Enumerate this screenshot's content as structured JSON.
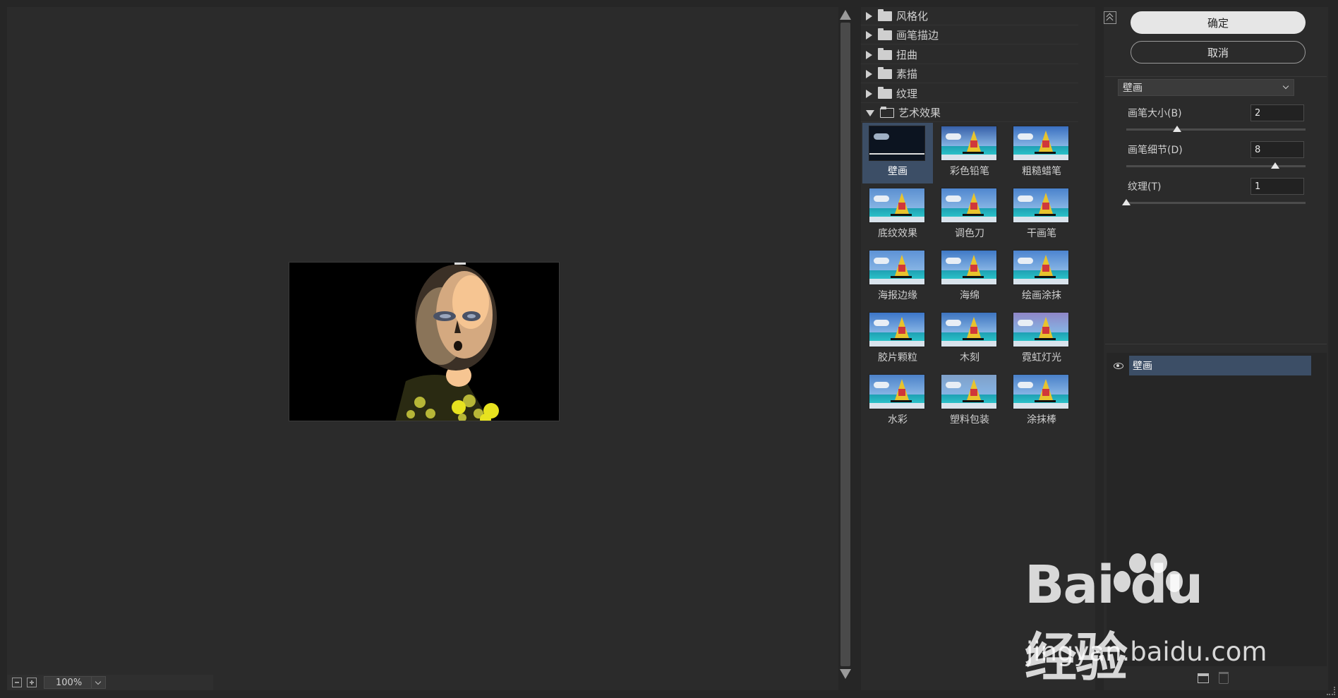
{
  "categories": [
    {
      "label": "风格化",
      "open": false
    },
    {
      "label": "画笔描边",
      "open": false
    },
    {
      "label": "扭曲",
      "open": false
    },
    {
      "label": "素描",
      "open": false
    },
    {
      "label": "纹理",
      "open": false
    },
    {
      "label": "艺术效果",
      "open": true
    }
  ],
  "thumbnails": [
    {
      "label": "壁画",
      "selected": true
    },
    {
      "label": "彩色铅笔"
    },
    {
      "label": "粗糙蜡笔"
    },
    {
      "label": "底纹效果"
    },
    {
      "label": "调色刀"
    },
    {
      "label": "干画笔"
    },
    {
      "label": "海报边缘"
    },
    {
      "label": "海绵"
    },
    {
      "label": "绘画涂抹"
    },
    {
      "label": "胶片颗粒"
    },
    {
      "label": "木刻"
    },
    {
      "label": "霓虹灯光"
    },
    {
      "label": "水彩"
    },
    {
      "label": "塑料包装"
    },
    {
      "label": "涂抹棒"
    }
  ],
  "buttons": {
    "ok": "确定",
    "cancel": "取消"
  },
  "filter_select": {
    "value": "壁画"
  },
  "params": [
    {
      "label": "画笔大小(B)",
      "value": "2",
      "level": 0.17
    },
    {
      "label": "画笔细节(D)",
      "value": "8",
      "level": 0.8
    },
    {
      "label": "纹理(T)",
      "value": "1",
      "level": 0.0
    }
  ],
  "layer": {
    "name": "壁画"
  },
  "zoom": {
    "value": "100%"
  },
  "watermark": {
    "logo": "Bai du 经验",
    "url": "jingyan.baidu.com"
  },
  "icons": {
    "collapse": "double-chevron-up-icon",
    "eye": "eye-icon",
    "new_layer": "new-layer-icon",
    "delete_layer": "trash-icon",
    "folder": "folder-icon"
  },
  "colors": {
    "selection": "#3c4e66",
    "panel": "#2b2b2b",
    "ok_button": "#e6e6e6"
  }
}
